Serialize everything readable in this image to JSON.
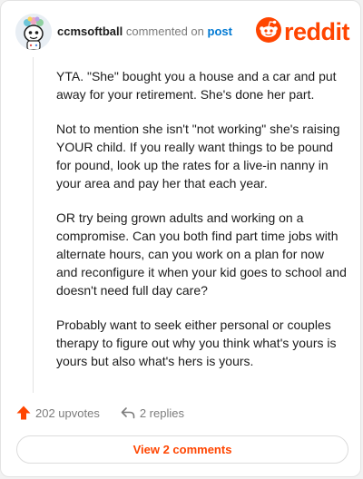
{
  "header": {
    "username": "ccmsoftball",
    "commented_text": "commented on",
    "post_link": "post",
    "logo_text": "reddit"
  },
  "comment": {
    "paragraphs": [
      "YTA. \"She\" bought you a house and a car and put away for your retirement. She's done her part.",
      "Not to mention she isn't \"not working\" she's raising YOUR child. If you really want things to be pound for pound, look up the rates for a live-in nanny in your area and pay her that each year.",
      "OR try being grown adults and working on a compromise. Can you both find part time jobs with alternate hours, can you work on a plan for now and reconfigure it when your kid goes to school and doesn't need full day care?",
      "Probably want to seek either personal or couples therapy to figure out why you think what's yours is yours but also what's hers is yours."
    ]
  },
  "actions": {
    "upvotes": "202 upvotes",
    "replies": "2 replies"
  },
  "view_comments_label": "View 2 comments",
  "colors": {
    "brand": "#ff4500",
    "link": "#0079d3",
    "text": "#1c1c1c",
    "muted": "#7c7c7c"
  },
  "icons": [
    "avatar",
    "reddit-snoo-icon",
    "upvote-arrow-icon",
    "reply-icon"
  ]
}
